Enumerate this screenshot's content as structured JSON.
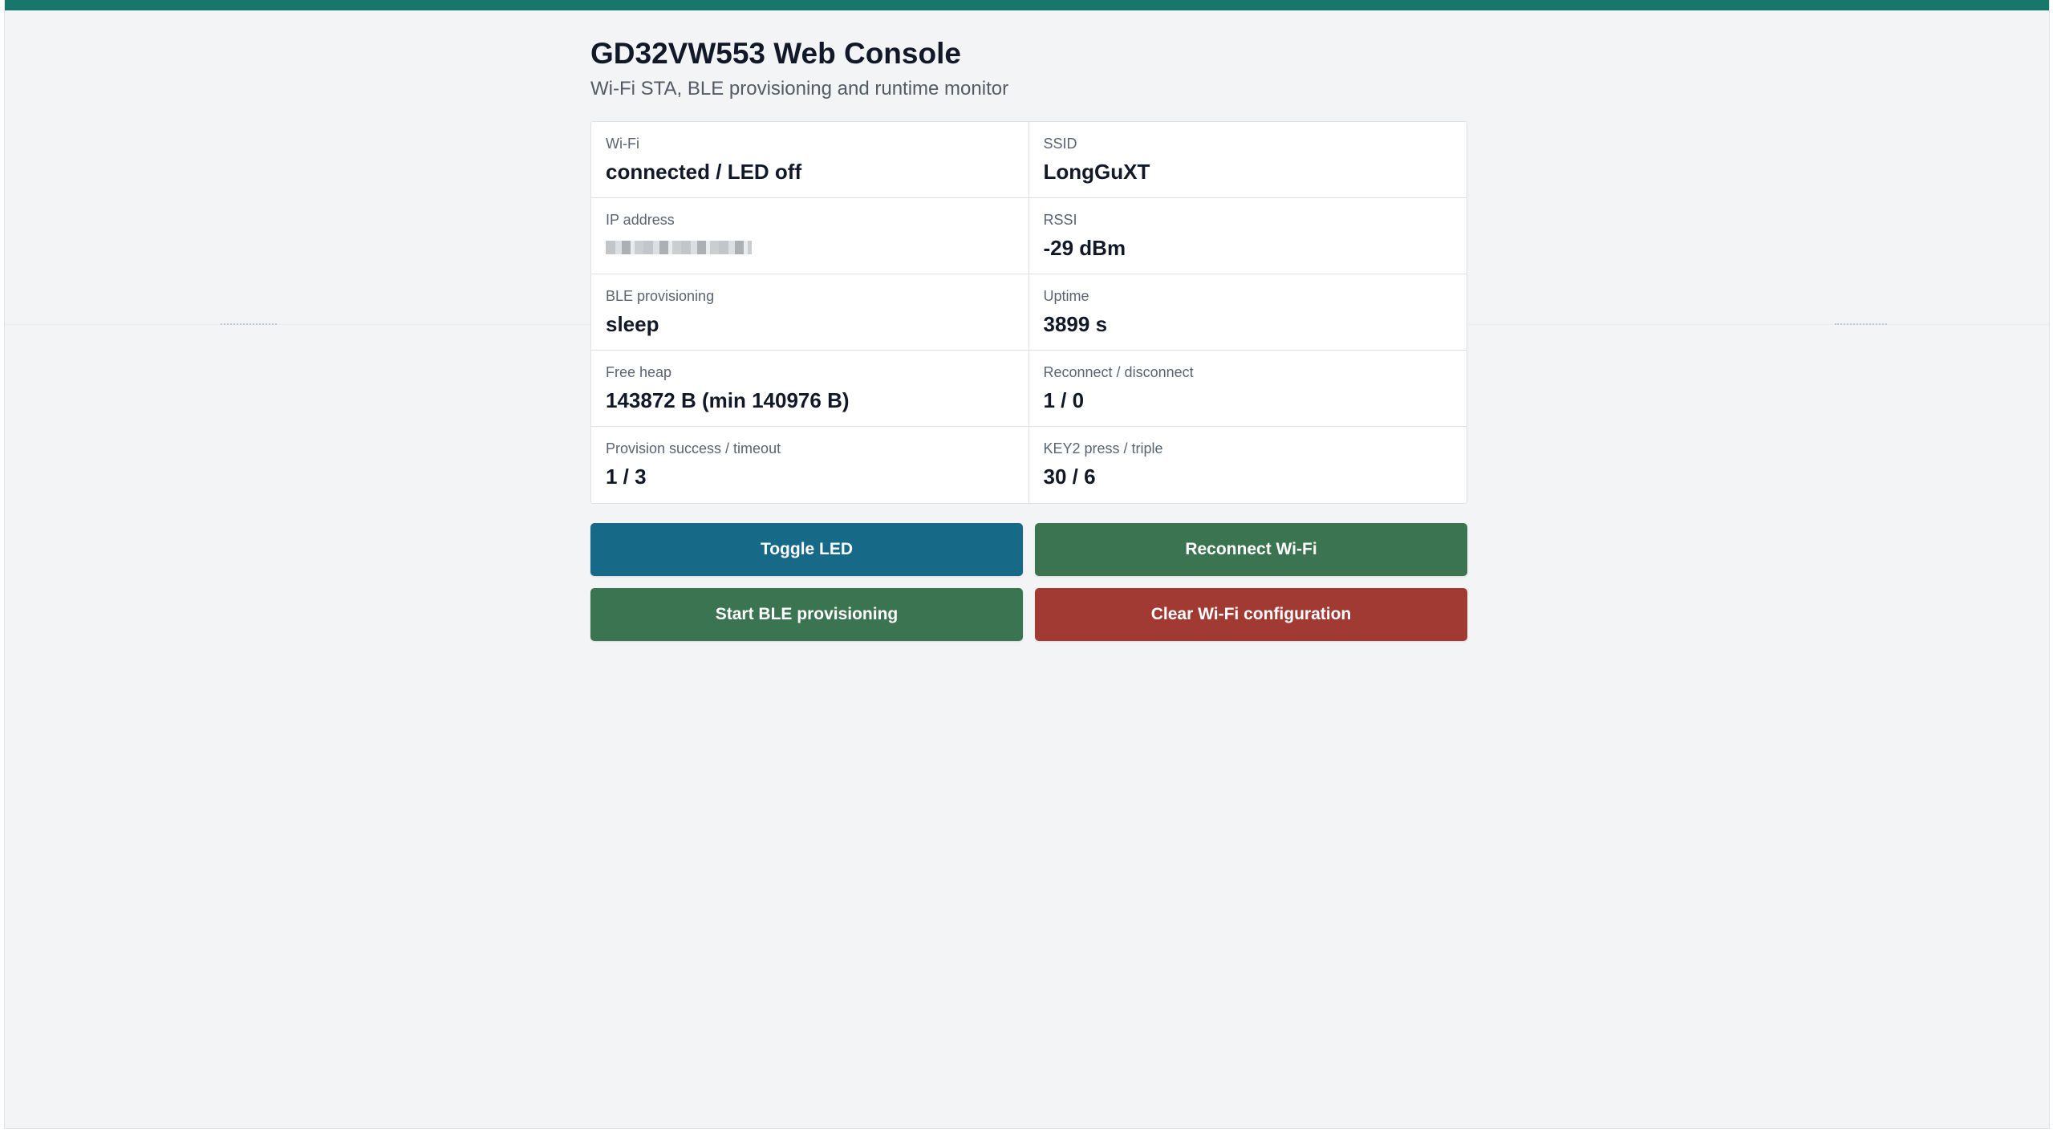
{
  "colors": {
    "accent_bar": "#17776b",
    "toggle_led": "#176a87",
    "reconnect_wifi": "#3b7450",
    "start_ble": "#3b7450",
    "clear_wifi": "#a23a34"
  },
  "header": {
    "title": "GD32VW553 Web Console",
    "subtitle": "Wi-Fi STA, BLE provisioning and runtime monitor"
  },
  "status": {
    "wifi": {
      "label": "Wi-Fi",
      "value": "connected / LED off"
    },
    "ssid": {
      "label": "SSID",
      "value": "LongGuXT"
    },
    "ip": {
      "label": "IP address",
      "value": ""
    },
    "rssi": {
      "label": "RSSI",
      "value": "-29 dBm"
    },
    "ble": {
      "label": "BLE provisioning",
      "value": "sleep"
    },
    "uptime": {
      "label": "Uptime",
      "value": "3899 s"
    },
    "heap": {
      "label": "Free heap",
      "value": "143872 B (min 140976 B)"
    },
    "reconnect": {
      "label": "Reconnect / disconnect",
      "value": "1 / 0"
    },
    "provision": {
      "label": "Provision success / timeout",
      "value": "1 / 3"
    },
    "key2": {
      "label": "KEY2 press / triple",
      "value": "30 / 6"
    }
  },
  "actions": {
    "toggle_led": "Toggle LED",
    "reconnect_wifi": "Reconnect Wi-Fi",
    "start_ble": "Start BLE provisioning",
    "clear_wifi": "Clear Wi-Fi configuration"
  }
}
